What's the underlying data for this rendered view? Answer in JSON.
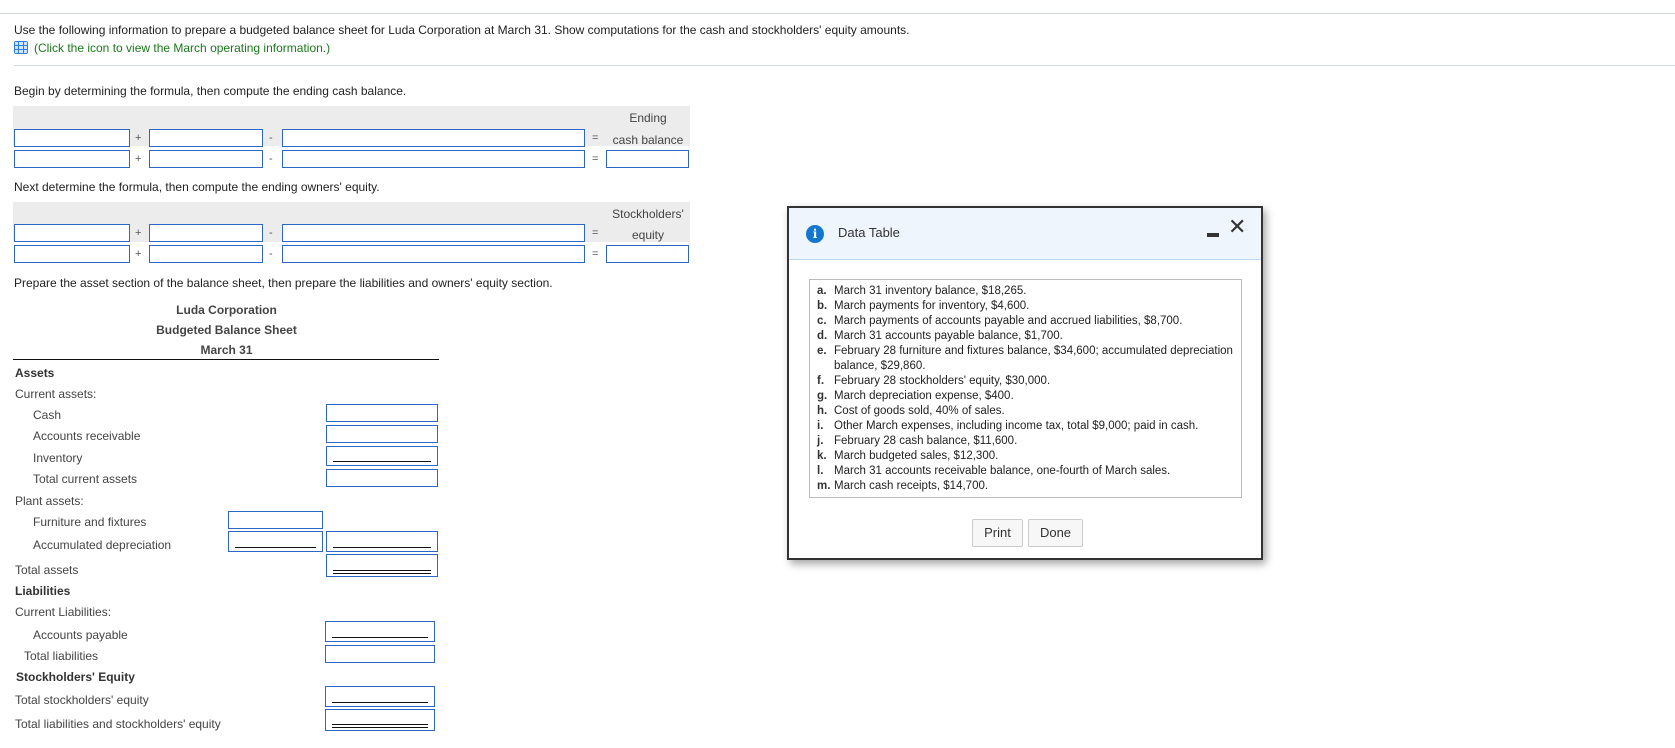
{
  "instructions": {
    "main": "Use the following information to prepare a budgeted balance sheet for Luda Corporation at March 31. Show computations for the cash and stockholders' equity amounts.",
    "link_text": "(Click the icon to view the March operating information.)",
    "link_icon": "table-grid-icon"
  },
  "cash_section": {
    "prompt": "Begin by determining the formula, then compute the ending cash balance.",
    "result_header_line1": "Ending",
    "result_header_line2": "cash balance",
    "op_plus": "+",
    "op_minus": "-",
    "op_equals": "="
  },
  "equity_section": {
    "prompt": "Next determine the formula, then compute the ending owners' equity.",
    "result_header_line1": "Stockholders'",
    "result_header_line2": "equity",
    "op_plus": "+",
    "op_minus": "-",
    "op_equals": "="
  },
  "balance_sheet": {
    "prompt": "Prepare the asset section of the balance sheet, then prepare the liabilities and owners' equity section.",
    "company": "Luda Corporation",
    "title": "Budgeted Balance Sheet",
    "date": "March 31",
    "rows": {
      "assets": "Assets",
      "current_assets": "Current assets:",
      "cash": "Cash",
      "accounts_receivable": "Accounts receivable",
      "inventory": "Inventory",
      "total_current_assets": "Total current assets",
      "plant_assets": "Plant assets:",
      "furniture": "Furniture and fixtures",
      "accum_dep": "Accumulated depreciation",
      "total_assets": "Total assets",
      "liabilities": "Liabilities",
      "current_liabilities": "Current Liabilities:",
      "accounts_payable": "Accounts payable",
      "total_liabilities": "Total liabilities",
      "se_header": "Stockholders' Equity",
      "total_se": "Total stockholders' equity",
      "total_l_se": "Total liabilities and stockholders' equity"
    }
  },
  "modal": {
    "title": "Data Table",
    "icon": "info-icon",
    "items": [
      {
        "letter": "a.",
        "text": "March 31 inventory balance, $18,265."
      },
      {
        "letter": "b.",
        "text": "March payments for inventory, $4,600."
      },
      {
        "letter": "c.",
        "text": "March payments of accounts payable and accrued liabilities, $8,700."
      },
      {
        "letter": "d.",
        "text": "March 31 accounts payable balance, $1,700."
      },
      {
        "letter": "e.",
        "text": "February 28 furniture and fixtures balance, $34,600; accumulated depreciation balance, $29,860."
      },
      {
        "letter": "f.",
        "text": "February 28 stockholders' equity, $30,000."
      },
      {
        "letter": "g.",
        "text": "March depreciation expense, $400."
      },
      {
        "letter": "h.",
        "text": "Cost of goods sold, 40% of sales."
      },
      {
        "letter": "i.",
        "text": "Other March expenses, including income tax, total $9,000; paid in cash."
      },
      {
        "letter": "j.",
        "text": "February 28 cash balance, $11,600."
      },
      {
        "letter": "k.",
        "text": "March budgeted sales, $12,300."
      },
      {
        "letter": "l.",
        "text": "March 31 accounts receivable balance, one-fourth of March sales."
      },
      {
        "letter": "m.",
        "text": "March cash receipts, $14,700."
      }
    ],
    "print_label": "Print",
    "done_label": "Done"
  }
}
